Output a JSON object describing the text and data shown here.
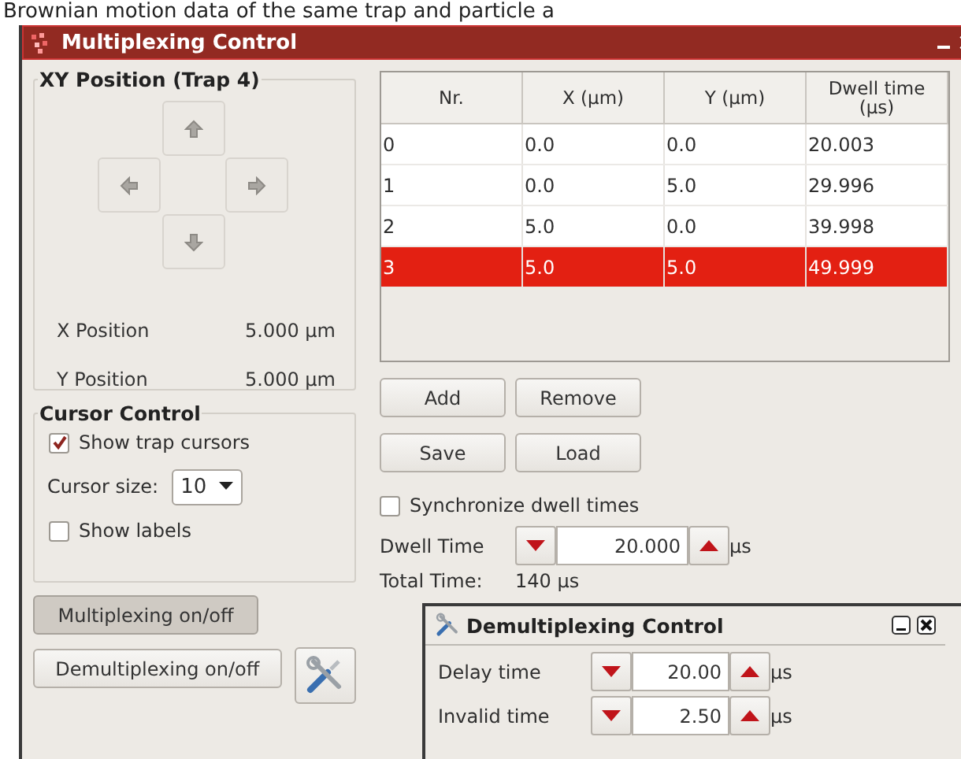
{
  "background_text": "Brownian motion data of the same trap and particle a",
  "window": {
    "title": "Multiplexing Control"
  },
  "xy_position": {
    "title": "XY Position (Trap 4)",
    "x_label": "X Position",
    "x_value": "5.000 µm",
    "y_label": "Y Position",
    "y_value": "5.000 µm"
  },
  "cursor_control": {
    "title": "Cursor Control",
    "show_trap_cursors": {
      "label": "Show trap cursors",
      "checked": true
    },
    "cursor_size": {
      "label": "Cursor size:",
      "value": "10"
    },
    "show_labels": {
      "label": "Show labels",
      "checked": false
    }
  },
  "buttons": [
    {
      "label": "Multiplexing on/off",
      "pressed": true
    },
    {
      "label": "Demultiplexing on/off",
      "pressed": false
    }
  ],
  "table": {
    "columns": [
      "Nr.",
      "X (µm)",
      "Y (µm)",
      "Dwell time (µs)"
    ],
    "rows": [
      {
        "cells": [
          "0",
          "0.0",
          "0.0",
          "20.003"
        ],
        "selected": false
      },
      {
        "cells": [
          "1",
          "0.0",
          "5.0",
          "29.996"
        ],
        "selected": false
      },
      {
        "cells": [
          "2",
          "5.0",
          "0.0",
          "39.998"
        ],
        "selected": false
      },
      {
        "cells": [
          "3",
          "5.0",
          "5.0",
          "49.999"
        ],
        "selected": true
      }
    ]
  },
  "list_buttons": [
    "Add",
    "Remove",
    "Save",
    "Load"
  ],
  "synchronize": {
    "label": "Synchronize dwell times",
    "checked": false
  },
  "dwell_time": {
    "label": "Dwell Time",
    "value": "20.000",
    "unit": "µs"
  },
  "total_time": {
    "label": "Total Time:",
    "value": "140 µs"
  },
  "demux_window": {
    "title": "Demultiplexing Control",
    "fields": [
      {
        "label": "Delay time",
        "value": "20.00",
        "unit": "µs"
      },
      {
        "label": "Invalid time",
        "value": "2.50",
        "unit": "µs"
      }
    ]
  }
}
